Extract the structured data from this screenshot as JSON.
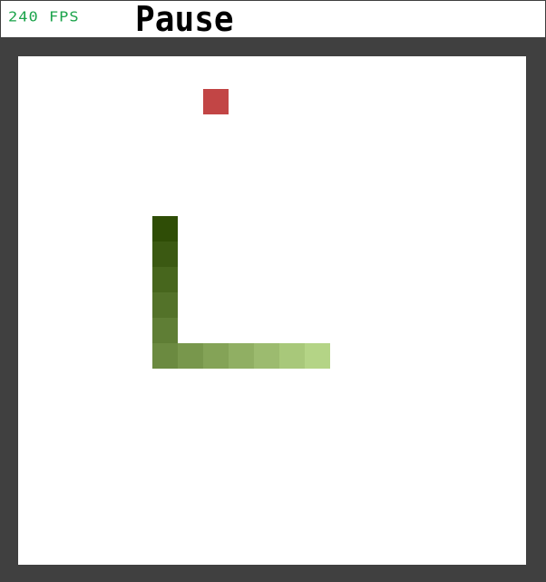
{
  "hud": {
    "fps_text": "240 FPS",
    "pause_label": "Pause"
  },
  "colors": {
    "frame": "#404040",
    "board": "#ffffff",
    "fps": "#1aa34a",
    "food": "#c24545",
    "snake_head": "#2f4d06",
    "snake_tail": "#b4d486"
  },
  "game": {
    "grid_cells": 20,
    "food": {
      "col": 8,
      "row": 2
    },
    "snake": [
      {
        "col": 6,
        "row": 7
      },
      {
        "col": 6,
        "row": 8
      },
      {
        "col": 6,
        "row": 9
      },
      {
        "col": 6,
        "row": 10
      },
      {
        "col": 6,
        "row": 11
      },
      {
        "col": 6,
        "row": 12
      },
      {
        "col": 7,
        "row": 12
      },
      {
        "col": 8,
        "row": 12
      },
      {
        "col": 9,
        "row": 12
      },
      {
        "col": 10,
        "row": 12
      },
      {
        "col": 11,
        "row": 12
      },
      {
        "col": 12,
        "row": 12
      }
    ]
  }
}
